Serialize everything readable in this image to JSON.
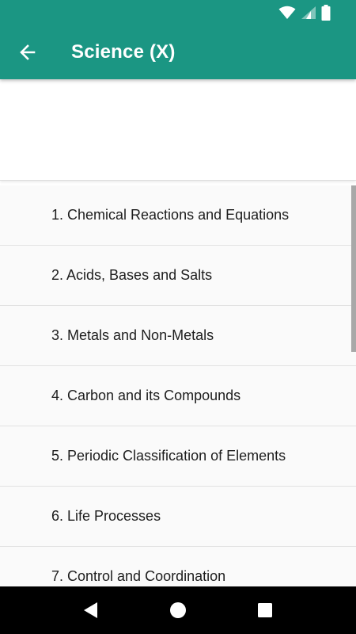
{
  "app_bar": {
    "title": "Science (X)",
    "color": "#1b9683",
    "back_icon": "arrow-left-icon"
  },
  "status_bar": {
    "icons": [
      "wifi-icon",
      "cellular-signal-icon",
      "battery-icon"
    ]
  },
  "chapters": [
    {
      "label": "1. Chemical Reactions and Equations"
    },
    {
      "label": "2. Acids, Bases and Salts"
    },
    {
      "label": "3. Metals and Non-Metals"
    },
    {
      "label": "4. Carbon and its Compounds"
    },
    {
      "label": "5. Periodic Classification of Elements"
    },
    {
      "label": "6. Life Processes"
    },
    {
      "label": "7. Control and Coordination"
    }
  ],
  "nav_bar": {
    "buttons": [
      "back-triangle-icon",
      "home-circle-icon",
      "recents-square-icon"
    ]
  }
}
